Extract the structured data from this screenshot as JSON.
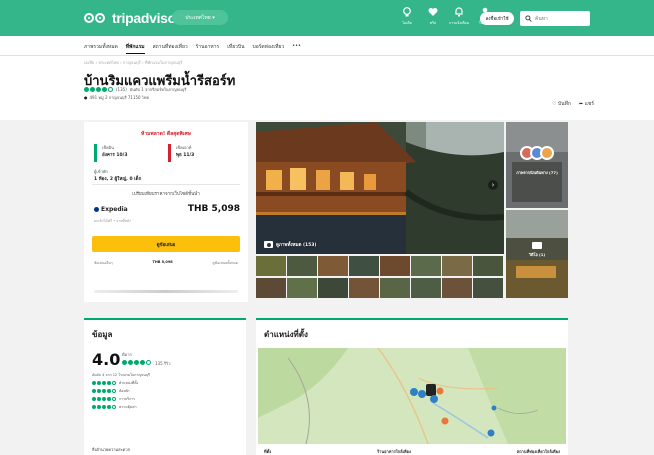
{
  "brand": {
    "name": "tripadvisor",
    "accent": "#34b68a",
    "deal_color": "#fbbf0c",
    "rating_color": "#00aa6c"
  },
  "topbar": {
    "country_button": "ประเทศไทย ▾",
    "nav": [
      {
        "label": "ไอเดีย",
        "icon": "bulb-icon"
      },
      {
        "label": "ทริป",
        "icon": "heart-icon"
      },
      {
        "label": "การแจ้งเตือน",
        "icon": "bell-icon"
      },
      {
        "label": "โปรไฟล์",
        "icon": "profile-icon"
      }
    ],
    "signin": "ลงชื่อเข้าใช้",
    "search_placeholder": "ค้นหา"
  },
  "subnav": {
    "items": [
      "ภาพรวมทั้งหมด",
      "ที่พักแรม",
      "สถานที่ท่องเที่ยว",
      "ร้านอาหาร",
      "เที่ยวบิน",
      "บอร์ดท่องเที่ยว",
      "•••"
    ],
    "active_index": 1
  },
  "header": {
    "breadcrumb": "เอเชีย › ประเทศไทย › กาญจนบุรี › ที่พักแรมในกาญจนบุรี",
    "title": "บ้านริมแควแพรีมน้ำรีสอร์ท",
    "review_count": "(135)",
    "rank_text": "อันดับ 1 จากรีสอร์ทในกาญจนบุรี",
    "address": "491 หมู่ 2 กาญจนบุรี 71150 ไทย",
    "save_label": "บันทึก",
    "share_label": "แชร์"
  },
  "booking": {
    "promo": "ห้ามพลาด! ดีลสุดพิเศษ",
    "checkin_label": "เช็คอิน",
    "checkin_value": "อังคาร 10/3",
    "checkout_label": "เช็คเอาท์",
    "checkout_value": "พุธ 11/3",
    "guests_label": "ผู้เข้าพัก",
    "guests_value": "1 ห้อง, 2 ผู้ใหญ่, 0 เด็ก",
    "compare_note": "เปรียบเทียบราคาจากเว็บไซต์ชั้นนำ",
    "provider": "Expedia",
    "price": "THB 5,098",
    "small_note": "ยกเลิกได้ฟรี • จ่ายทีหลัง",
    "deal_button": "ดูข้อเสนอ",
    "more_left": "ข้อเสนออื่นๆ",
    "more_middle": "THB 5,098",
    "more_right": "ดูข้อเสนอทั้งหมด"
  },
  "gallery": {
    "caption": "ดูภาพทั้งหมด (153)",
    "side_top_label": "ภาพจากนักเดินทาง (77)",
    "side_bottom_label": "วิดีโอ (1)"
  },
  "info": {
    "title": "ข้อมูล",
    "score": "4.0",
    "score_word": "ดีมาก",
    "score_reviews": "135 รีวิว",
    "rank": "อันดับ 4 จาก 12 โรงแรมในกาญจนบุรี",
    "sub_ratings": [
      "ตำแหน่งที่ตั้ง",
      "ห้องพัก",
      "การบริการ",
      "ความคุ้มค่า"
    ],
    "amenities_title": "สิ่งอำนวยความสะดวก"
  },
  "location": {
    "title": "ตำแหน่งที่ตั้ง",
    "columns": [
      "ที่ตั้ง",
      "ร้านอาหารใกล้เคียง",
      "สถานที่ท่องเที่ยวใกล้เคียง"
    ]
  }
}
